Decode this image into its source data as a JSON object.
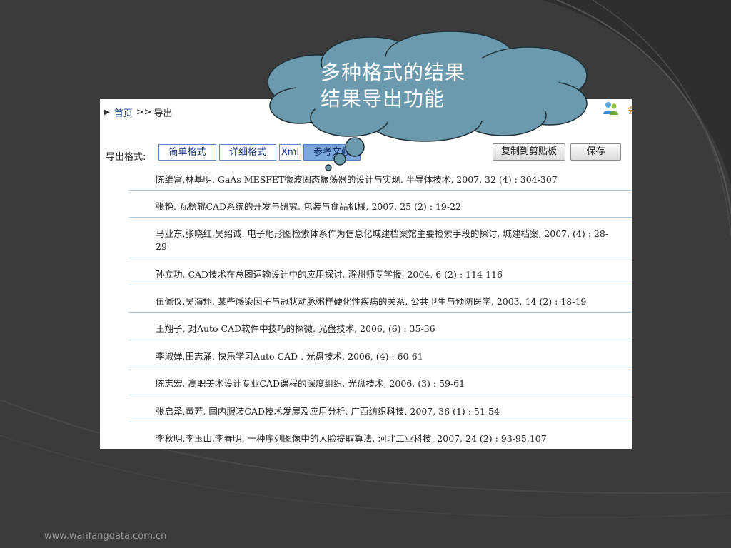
{
  "breadcrumb": {
    "home": "首页",
    "separator": ">>",
    "current": "导出"
  },
  "format_label": "导出格式:",
  "format_buttons": [
    {
      "label": "简单格式",
      "active": false
    },
    {
      "label": "详细格式",
      "active": false
    },
    {
      "label": "Xml",
      "active": false
    },
    {
      "label": "参考文献",
      "active": true
    }
  ],
  "actions": {
    "copy": "复制到剪贴板",
    "save": "保存"
  },
  "results": [
    "陈维富,林基明. GaAs MESFET微波固态振荡器的设计与实现. 半导体技术, 2007, 32 (4) : 304-307",
    "张艳. 瓦楞辊CAD系统的开发与研究. 包装与食品机械, 2007, 25 (2) : 19-22",
    "马业东,张晓红,吴绍诚. 电子地形图检索体系作为信息化城建档案馆主要检索手段的探讨. 城建档案, 2007, (4) : 28-29",
    "孙立功. CAD技术在总图运输设计中的应用探讨. 滁州师专学报, 2004, 6 (2) : 114-116",
    "伍佩仪,吴海翔. 某些感染因子与冠状动脉粥样硬化性疾病的关系. 公共卫生与预防医学, 2003, 14 (2) : 18-19",
    "王翔子. 对Auto CAD软件中技巧的探微. 光盘技术, 2006, (6) : 35-36",
    "李淑婵,田志涌. 快乐学习Auto CAD . 光盘技术, 2006, (4) : 60-61",
    "陈志宏. 高职美术设计专业CAD课程的深度组织. 光盘技术, 2006, (3) : 59-61",
    "张启泽,黄芳. 国内服装CAD技术发展及应用分析. 广西纺织科技, 2007, 36 (1) : 51-54",
    "李秋明,李玉山,李春明. 一种序列图像中的人脸提取算法. 河北工业科技, 2007, 24 (2) : 93-95,107"
  ],
  "callout": {
    "line1": "多种格式的结果",
    "line2": "结果导出功能"
  },
  "footer": "www.wanfangdata.com.cn",
  "colors": {
    "background": "#3b3b3b",
    "cloud": "#6b99ad",
    "cloud_border": "#1e2f36",
    "row_divider": "#a7c4e6",
    "link": "#1e3f8a"
  }
}
